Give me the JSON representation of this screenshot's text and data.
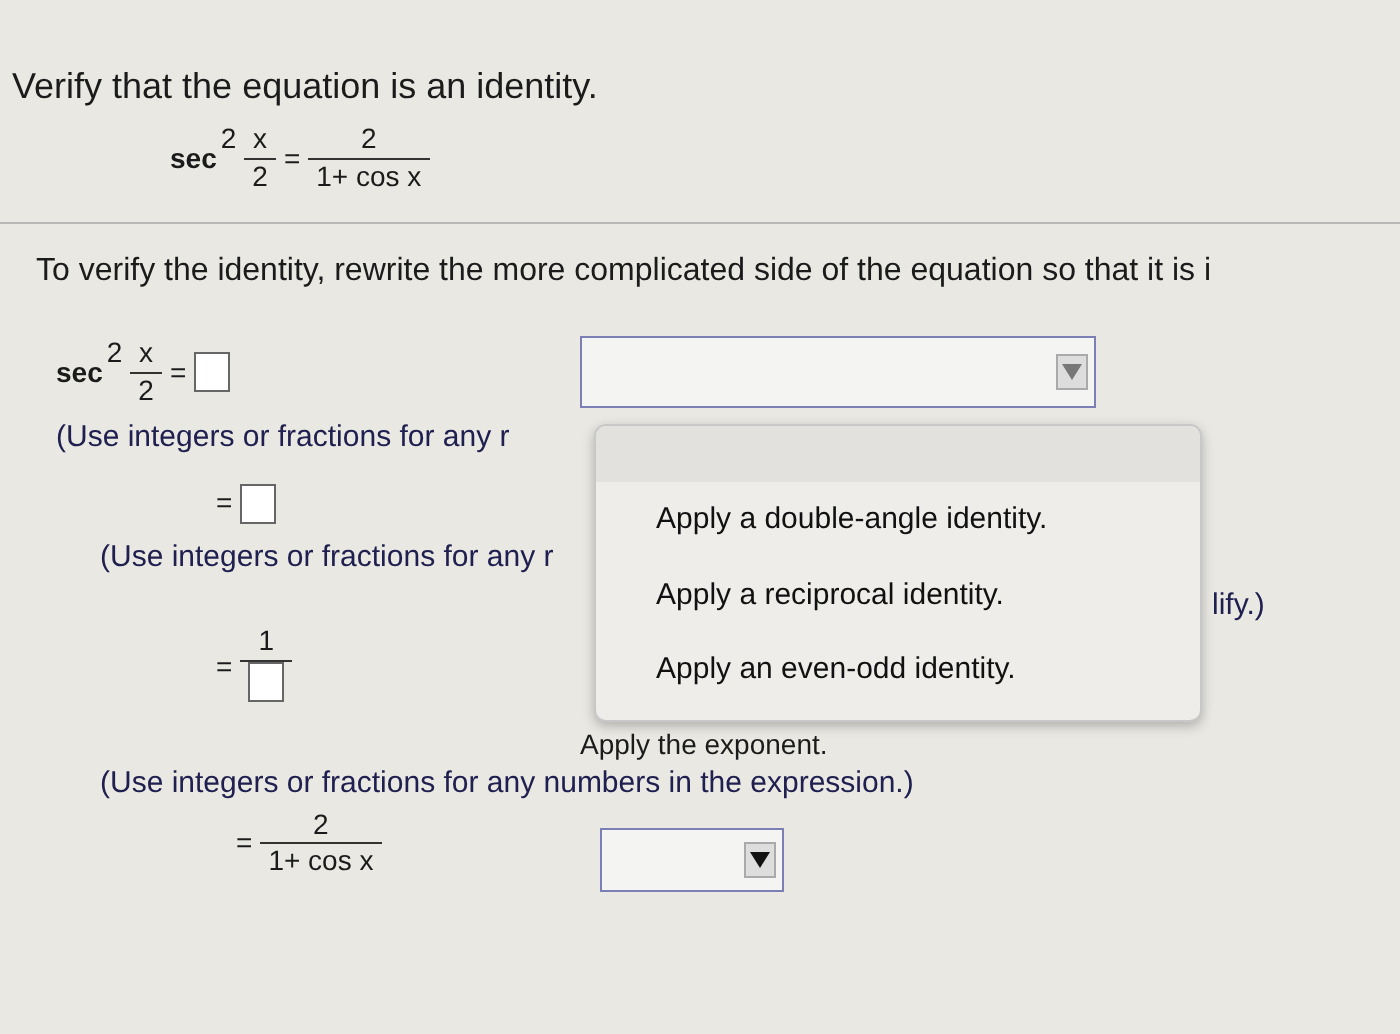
{
  "title": "Verify that the equation is an identity.",
  "equation": {
    "lhs": {
      "func": "sec",
      "power": "2",
      "num": "x",
      "den": "2"
    },
    "equals": "=",
    "rhs": {
      "num": "2",
      "den": "1+ cos x"
    }
  },
  "instruction": "To verify the identity, rewrite the more complicated side of the equation so that it is i",
  "steps": [
    {
      "expr": {
        "kind": "func_fraction",
        "func": "sec",
        "power": "2",
        "num": "x",
        "den": "2"
      },
      "equals": "=",
      "answer": {
        "kind": "box"
      },
      "hint": "(Use integers or fractions for any r",
      "select": {
        "hover": true
      },
      "menu": [
        "Apply a double-angle identity.",
        "Apply a reciprocal identity.",
        "Apply an even-odd identity."
      ]
    },
    {
      "equals": "=",
      "answer": {
        "kind": "box"
      },
      "hint": "(Use integers or fractions for any r",
      "hint_tail": "lify.)"
    },
    {
      "equals": "=",
      "answer": {
        "kind": "fraction_box",
        "num": "1"
      },
      "reason": "Apply the exponent.",
      "hint": "(Use integers or fractions for any numbers in the expression.)"
    },
    {
      "equals": "=",
      "answer": {
        "kind": "fraction",
        "num": "2",
        "den": "1+ cos x"
      },
      "select": {
        "hover": false
      }
    }
  ]
}
